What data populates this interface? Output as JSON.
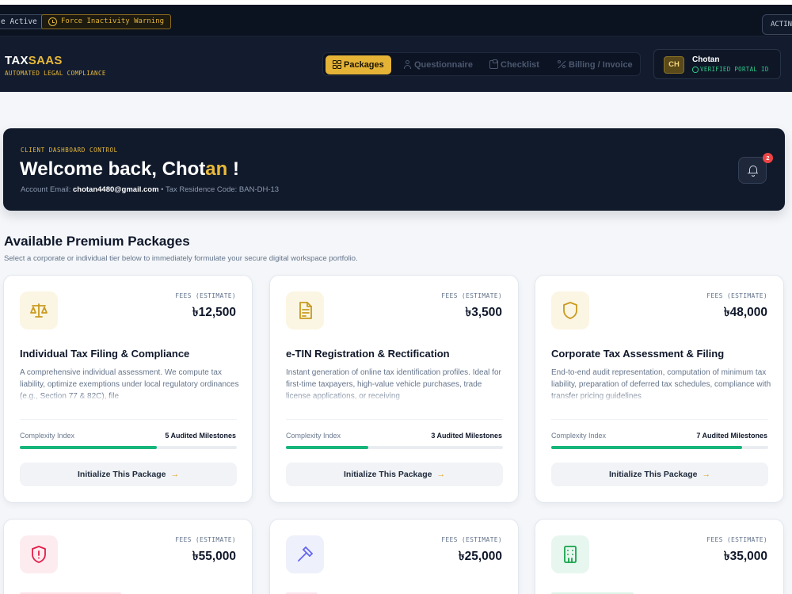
{
  "status_bar": {
    "active_label": "e Active",
    "warning_label": "Force Inactivity Warning",
    "right_label": "ACTIN"
  },
  "header": {
    "logo_main": "TAX",
    "logo_accent": "SAAS",
    "logo_sub": "AUTOMATED LEGAL COMPLIANCE",
    "nav": [
      {
        "label": "Packages",
        "icon": "grid-icon",
        "active": true
      },
      {
        "label": "Questionnaire",
        "icon": "user-icon",
        "active": false
      },
      {
        "label": "Checklist",
        "icon": "clipboard-icon",
        "active": false
      },
      {
        "label": "Billing / Invoice",
        "icon": "percent-icon",
        "active": false
      }
    ],
    "user": {
      "initials": "CH",
      "name": "Chotan",
      "status": "VERIFIED PORTAL ID"
    }
  },
  "banner": {
    "eyebrow": "CLIENT DASHBOARD CONTROL",
    "greeting": "Welcome back, ",
    "name_part1": "Chot",
    "name_part2": "an",
    "exclaim": " !",
    "email_label": "Account Email: ",
    "email": "chotan4480@gmail.com",
    "separator": " • ",
    "residence": "Tax Residence Code: BAN-DH-13",
    "notification_count": "2"
  },
  "section": {
    "title": "Available Premium Packages",
    "subtitle": "Select a corporate or individual tier below to immediately formulate your secure digital workspace portfolio."
  },
  "colors": {
    "accent_gold": "#e5b437",
    "progress_green": "#16b67b",
    "dark_navy": "#111a2b"
  },
  "packages": [
    {
      "icon": "scales-icon",
      "fee_label": "FEES (ESTIMATE)",
      "fee": "৳12,500",
      "title": "Individual Tax Filing & Compliance",
      "description": "A comprehensive individual assessment. We compute tax liability, optimize exemptions under local regulatory ordinances (e.g., Section 77 & 82C), file",
      "complexity_label": "Complexity Index",
      "milestones": "5 Audited Milestones",
      "complexity": 0.63,
      "button": "Initialize This Package"
    },
    {
      "icon": "document-icon",
      "fee_label": "FEES (ESTIMATE)",
      "fee": "৳3,500",
      "title": "e-TIN Registration & Rectification",
      "description": "Instant generation of online tax identification profiles. Ideal for first-time taxpayers, high-value vehicle purchases, trade license applications, or receiving",
      "complexity_label": "Complexity Index",
      "milestones": "3 Audited Milestones",
      "complexity": 0.38,
      "button": "Initialize This Package"
    },
    {
      "icon": "shield-icon",
      "fee_label": "FEES (ESTIMATE)",
      "fee": "৳48,000",
      "title": "Corporate Tax Assessment & Filing",
      "description": "End-to-end audit representation, computation of minimum tax liability, preparation of deferred tax schedules, compliance with transfer pricing guidelines",
      "complexity_label": "Complexity Index",
      "milestones": "7 Audited Milestones",
      "complexity": 0.88,
      "button": "Initialize This Package"
    },
    {
      "icon": "shield-alert-icon",
      "fee_label": "FEES (ESTIMATE)",
      "fee": "৳55,000"
    },
    {
      "icon": "gavel-icon",
      "fee_label": "FEES (ESTIMATE)",
      "fee": "৳25,000"
    },
    {
      "icon": "building-icon",
      "fee_label": "FEES (ESTIMATE)",
      "fee": "৳35,000"
    }
  ]
}
